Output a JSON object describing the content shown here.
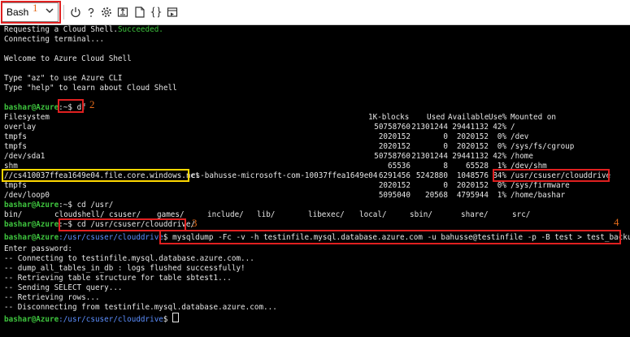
{
  "toolbar": {
    "shell_select": "Bash",
    "icons": [
      "power-icon",
      "help-icon",
      "settings-icon",
      "upload-download-icon",
      "open-editor-icon",
      "braces-icon",
      "web-preview-icon"
    ]
  },
  "annotations": {
    "n1": "1",
    "n2": "2",
    "n3": "3",
    "n4": "4"
  },
  "terminal": {
    "l1a": "Requesting a Cloud Shell.",
    "l1b": "Succeeded.",
    "l2": "Connecting terminal...",
    "l3": "Welcome to Azure Cloud Shell",
    "l4": "Type \"az\" to use Azure CLI",
    "l5": "Type \"help\" to learn about Cloud Shell",
    "prompt_user": "bashar@Azure",
    "prompt_home": ":~$ ",
    "cmd_df": "df",
    "df_header": {
      "fs": "Filesystem",
      "blocks": "1K-blocks",
      "used": "Used",
      "avail": "Available",
      "use": "Use%",
      "mount": "Mounted on"
    },
    "df_rows": [
      {
        "fs": "overlay",
        "blocks": "50758760",
        "used": "21301244",
        "avail": "29441132",
        "use": "42%",
        "mount": "/"
      },
      {
        "fs": "tmpfs",
        "blocks": "2020152",
        "used": "0",
        "avail": "2020152",
        "use": "0%",
        "mount": "/dev"
      },
      {
        "fs": "tmpfs",
        "blocks": "2020152",
        "used": "0",
        "avail": "2020152",
        "use": "0%",
        "mount": "/sys/fs/cgroup"
      },
      {
        "fs": "/dev/sda1",
        "blocks": "50758760",
        "used": "21301244",
        "avail": "29441132",
        "use": "42%",
        "mount": "/home"
      },
      {
        "fs": "shm",
        "blocks": "65536",
        "used": "8",
        "avail": "65528",
        "use": "1%",
        "mount": "/dev/shm"
      },
      {
        "fs": "//cs410037ffea1649e04.file.core.windows.net",
        "share": "cs-bahusse-microsoft-com-10037ffea1649e04",
        "blocks": "6291456",
        "used": "5242880",
        "avail": "1048576",
        "use": "84%",
        "mount": "/usr/csuser/clouddrive"
      },
      {
        "fs": "tmpfs",
        "blocks": "2020152",
        "used": "0",
        "avail": "2020152",
        "use": "0%",
        "mount": "/sys/firmware"
      },
      {
        "fs": "/dev/loop0",
        "blocks": "5095040",
        "used": "20568",
        "avail": "4795944",
        "use": "1%",
        "mount": "/home/bashar"
      }
    ],
    "cmd_cd_usr": "cd /usr/",
    "ls_dirs": [
      "bin/",
      "cloudshell/",
      "csuser/",
      "games/",
      "include/",
      "lib/",
      "libexec/",
      "local/",
      "sbin/",
      "share/",
      "src/"
    ],
    "cmd_cd_clouddrive": "cd /usr/csuser/clouddrive/",
    "prompt_path": ":/usr/csuser/clouddrive",
    "prompt_dollar": "$ ",
    "cmd_mysqldump": "mysqldump -Fc -v -h testinfile.mysql.database.azure.com -u bahusse@testinfile -p -B test > test_backup.sql",
    "out1": "Enter password:",
    "out2": "-- Connecting to testinfile.mysql.database.azure.com...",
    "out3": "-- dump_all_tables_in_db : logs flushed successfully!",
    "out4": "-- Retrieving table structure for table sbtest1...",
    "out5": "-- Sending SELECT query...",
    "out6": "-- Retrieving rows...",
    "out7": "-- Disconnecting from testinfile.mysql.database.azure.com..."
  }
}
